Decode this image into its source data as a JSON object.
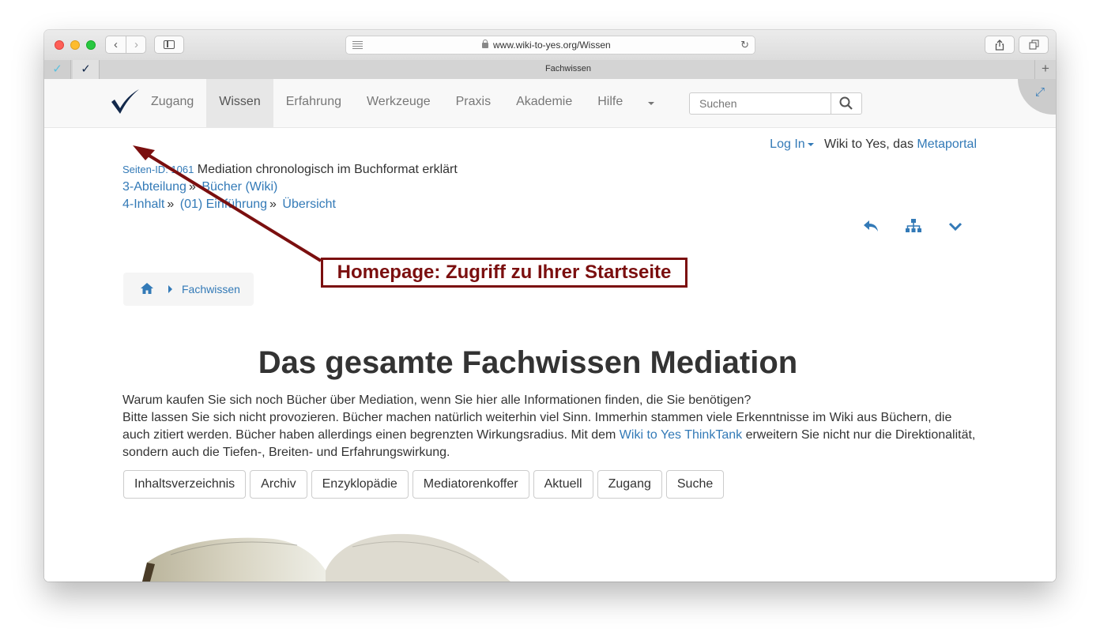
{
  "browser": {
    "url": "www.wiki-to-yes.org/Wissen",
    "tab_title": "Fachwissen"
  },
  "nav": {
    "items": [
      "Zugang",
      "Wissen",
      "Erfahrung",
      "Werkzeuge",
      "Praxis",
      "Akademie",
      "Hilfe"
    ],
    "search_placeholder": "Suchen"
  },
  "header": {
    "login": "Log In",
    "tagline": "Wiki to Yes, das",
    "metaportal": "Metaportal"
  },
  "meta": {
    "page_id_label": "Seiten-ID: 1061",
    "page_title": "Mediation chronologisch im Buchformat erklärt",
    "row2": [
      "3-Abteilung",
      "Bücher (Wiki)"
    ],
    "row3": [
      "4-Inhalt",
      "(01) Einführung",
      "Übersicht"
    ]
  },
  "breadcrumb": {
    "current": "Fachwissen"
  },
  "callout": "Homepage: Zugriff zu Ihrer Startseite",
  "main": {
    "heading": "Das gesamte Fachwissen Mediation",
    "line1": "Warum kaufen Sie sich noch Bücher über Mediation, wenn Sie hier alle Informationen finden, die Sie benötigen?",
    "line2a": "Bitte lassen Sie sich nicht provozieren. Bücher machen natürlich weiterhin viel Sinn. Immerhin stammen viele Erkenntnisse im Wiki aus Büchern, die auch zitiert werden. Bücher haben allerdings einen begrenzten Wirkungsradius. Mit dem ",
    "link": "Wiki to Yes ThinkTank",
    "line2b": " erweitern Sie nicht nur die Direktionalität, sondern auch die Tiefen-, Breiten- und Erfahrungswirkung.",
    "buttons": [
      "Inhaltsverzeichnis",
      "Archiv",
      "Enzyklopädie",
      "Mediatorenkoffer",
      "Aktuell",
      "Zugang",
      "Suche"
    ]
  },
  "colors": {
    "link": "#337ab7",
    "callout": "#7b0f0f",
    "logo": "#13294b"
  }
}
